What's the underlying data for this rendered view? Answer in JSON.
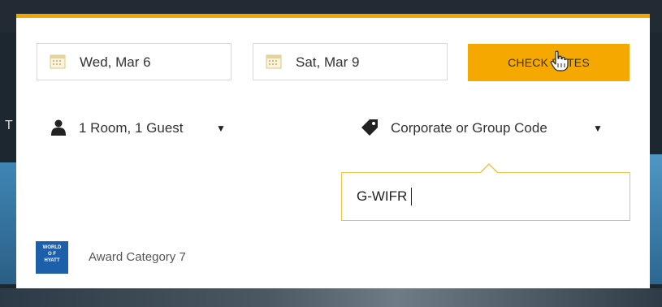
{
  "background": {
    "side_letter": "T"
  },
  "panel": {
    "accent_color": "#f0a500"
  },
  "checkin": {
    "icon": "calendar-icon",
    "value": "Wed, Mar 6"
  },
  "checkout": {
    "icon": "calendar-icon",
    "value": "Sat, Mar 9"
  },
  "check_rates": {
    "label": "CHECK RATES",
    "color": "#f5a800"
  },
  "guests": {
    "icon": "person-icon",
    "label": "1 Room, 1 Guest",
    "dropdown_icon": "caret-down-icon"
  },
  "special_code": {
    "icon": "tag-icon",
    "label": "Corporate or Group Code",
    "dropdown_icon": "caret-down-icon"
  },
  "code_input": {
    "value": "G-WIFR"
  },
  "award": {
    "logo_text": "WORLD OF HYATT",
    "label": "Award Category 7",
    "logo_color": "#1d5fa8"
  }
}
